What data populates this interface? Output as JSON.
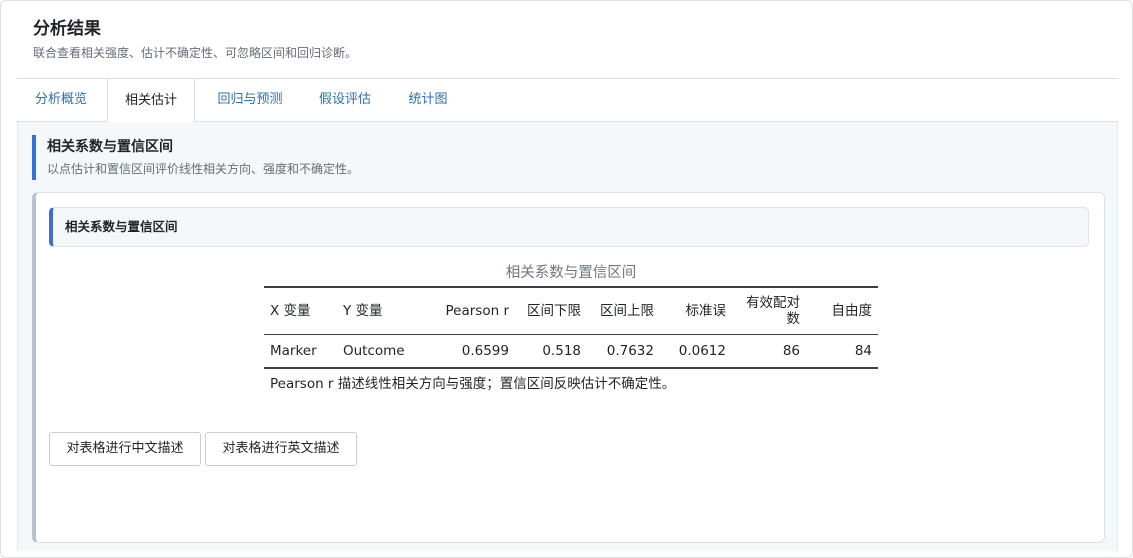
{
  "header": {
    "title": "分析结果",
    "subtitle": "联合查看相关强度、估计不确定性、可忽略区间和回归诊断。"
  },
  "tabs": [
    {
      "label": "分析概览",
      "active": false
    },
    {
      "label": "相关估计",
      "active": true
    },
    {
      "label": "回归与预测",
      "active": false
    },
    {
      "label": "假设评估",
      "active": false
    },
    {
      "label": "统计图",
      "active": false
    }
  ],
  "section": {
    "title": "相关系数与置信区间",
    "description": "以点估计和置信区间评价线性相关方向、强度和不确定性。"
  },
  "card": {
    "title": "相关系数与置信区间",
    "table": {
      "caption": "相关系数与置信区间",
      "columns": [
        "X 变量",
        "Y 变量",
        "Pearson r",
        "区间下限",
        "区间上限",
        "标准误",
        "有效配对数",
        "自由度"
      ],
      "rows": [
        [
          "Marker",
          "Outcome",
          "0.6599",
          "0.518",
          "0.7632",
          "0.0612",
          "86",
          "84"
        ]
      ],
      "note": "Pearson r 描述线性相关方向与强度；置信区间反映估计不确定性。"
    },
    "buttons": {
      "describe_cn": "对表格进行中文描述",
      "describe_en": "对表格进行英文描述"
    }
  },
  "colors": {
    "accent": "#3b6fd8",
    "tab_link": "#2f6fb6",
    "panel_bg": "#f5f8fb"
  }
}
